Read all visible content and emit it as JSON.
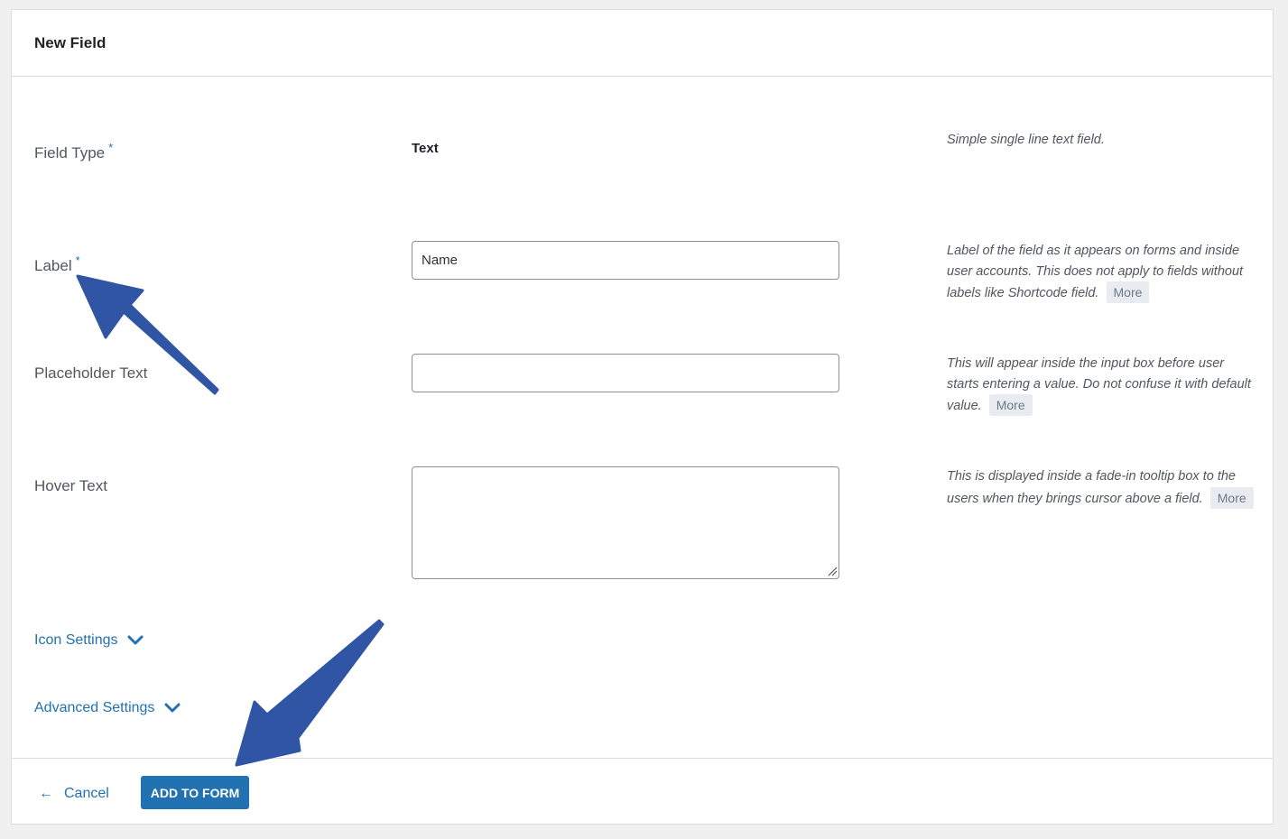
{
  "panel": {
    "title": "New Field"
  },
  "rows": {
    "field_type": {
      "label": "Field Type",
      "required_mark": "*",
      "value": "Text",
      "description": "Simple single line text field."
    },
    "label": {
      "label": "Label",
      "required_mark": "*",
      "input_value": "Name",
      "description": "Label of the field as it appears on forms and inside user accounts. This does not apply to fields without labels like Shortcode field.",
      "more": "More"
    },
    "placeholder": {
      "label": "Placeholder Text",
      "input_value": "",
      "description": "This will appear inside the input box before user starts entering a value. Do not confuse it with default value.",
      "more": "More"
    },
    "hover": {
      "label": "Hover Text",
      "input_value": "",
      "description": "This is displayed inside a fade-in tooltip box to the users when they brings cursor above a field.",
      "more": "More"
    }
  },
  "toggles": {
    "icon_settings": "Icon Settings",
    "advanced_settings": "Advanced Settings"
  },
  "footer": {
    "cancel_arrow": "←",
    "cancel_label": "Cancel",
    "add_button_label": "ADD TO FORM"
  },
  "colors": {
    "accent": "#2271b1",
    "annotation_arrow": "#2f55a4"
  },
  "icons": {
    "chevron": "chevron-down-icon",
    "resize": "resize-handle-icon"
  }
}
